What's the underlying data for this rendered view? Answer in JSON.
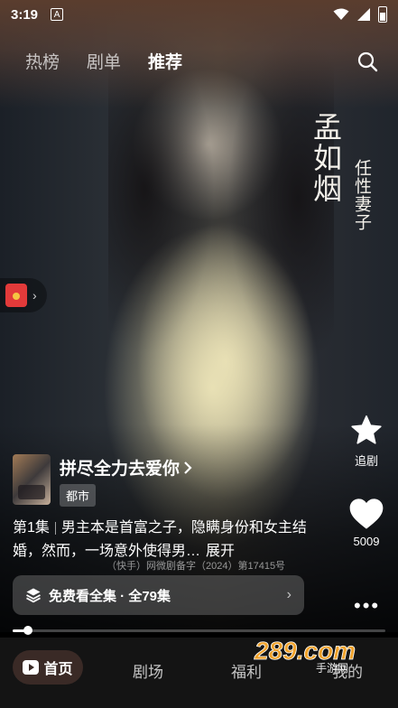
{
  "status_bar": {
    "time": "3:19",
    "notification_letter": "A"
  },
  "top_tabs": [
    {
      "label": "热榜",
      "active": false
    },
    {
      "label": "剧单",
      "active": false
    },
    {
      "label": "推荐",
      "active": true
    }
  ],
  "video": {
    "vertical_title": "孟如烟",
    "vertical_subtitle": "任性妻子"
  },
  "actions": {
    "follow_label": "追剧",
    "like_count": "5009"
  },
  "drama": {
    "title": "拼尽全力去爱你",
    "genre": "都市",
    "episode": "第1集",
    "description": "男主本是首富之子，隐瞒身份和女主结婚，然而，一场意外使得男…",
    "expand_label": "展开",
    "license": "（快手）网微剧备字（2024）第17415号"
  },
  "free_bar": {
    "label": "免费看全集 · 全79集"
  },
  "progress": {
    "fraction": 0.04
  },
  "bottom_nav": [
    {
      "label": "首页",
      "active": true
    },
    {
      "label": "剧场",
      "active": false
    },
    {
      "label": "福利",
      "active": false
    },
    {
      "label": "我的",
      "active": false
    }
  ],
  "watermark": {
    "text": "289.com",
    "subtext": "手游网"
  },
  "colors": {
    "accent_red": "#e23a3a",
    "nav_bg": "#141414",
    "home_pill": "#3a2a26"
  }
}
